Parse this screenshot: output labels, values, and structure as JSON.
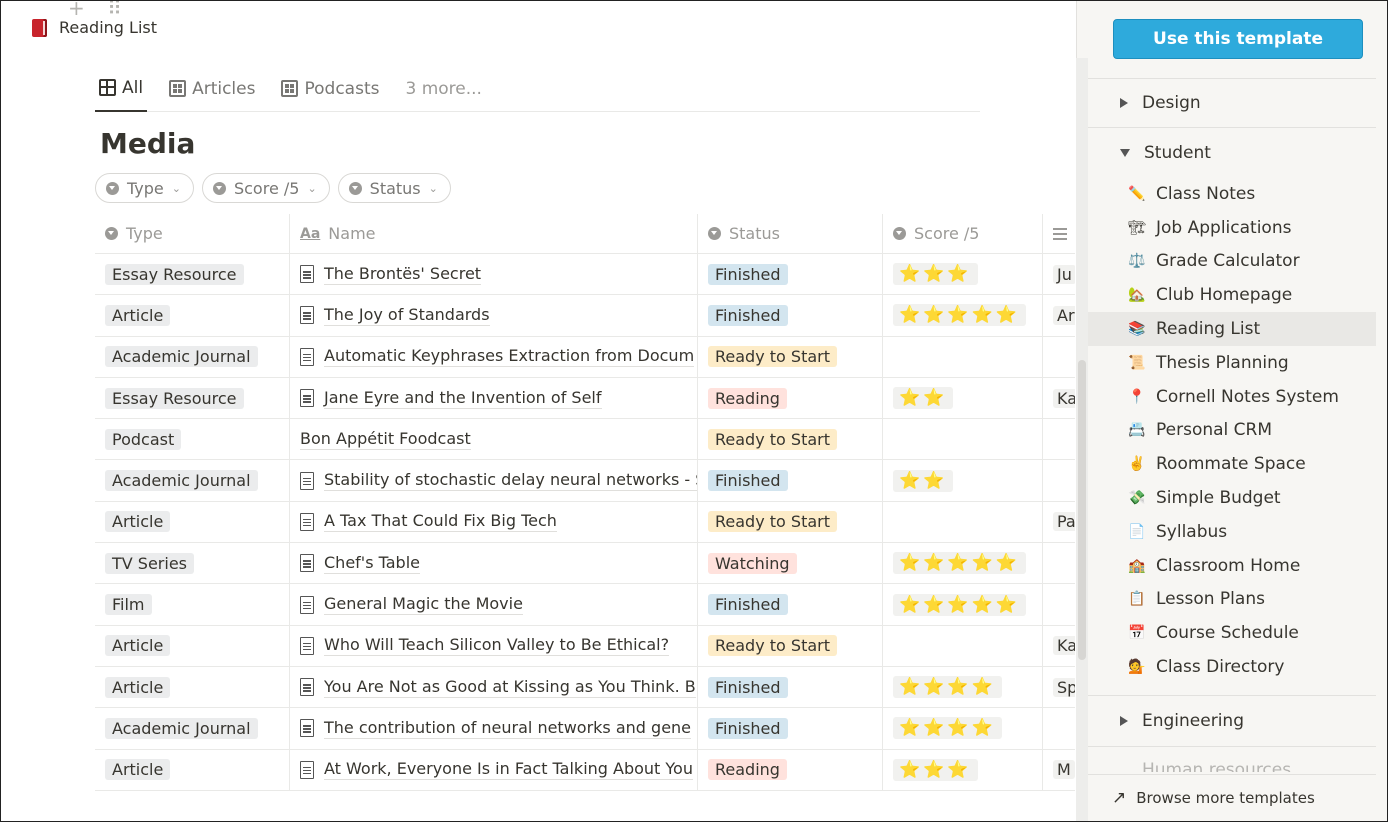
{
  "page": {
    "breadcrumb": "Reading List",
    "title": "Media"
  },
  "tabs": [
    {
      "label": "All"
    },
    {
      "label": "Articles"
    },
    {
      "label": "Podcasts"
    },
    {
      "label": "3 more..."
    }
  ],
  "filters": [
    "Type",
    "Score /5",
    "Status"
  ],
  "columns": {
    "type": "Type",
    "name": "Name",
    "status": "Status",
    "score": "Score /5"
  },
  "rows": [
    {
      "type": "Essay Resource",
      "name": "The Brontës' Secret",
      "status": "Finished",
      "score": "⭐⭐⭐",
      "extra": "Ju"
    },
    {
      "type": "Article",
      "name": "The Joy of Standards",
      "status": "Finished",
      "score": "⭐⭐⭐⭐⭐",
      "extra": "Ar"
    },
    {
      "type": "Academic Journal",
      "name": "Automatic Keyphrases Extraction from Docum",
      "status": "Ready to Start",
      "score": "",
      "extra": ""
    },
    {
      "type": "Essay Resource",
      "name": "Jane Eyre and the Invention of Self",
      "status": "Reading",
      "score": "⭐⭐",
      "extra": "Ka"
    },
    {
      "type": "Podcast",
      "name": "Bon Appétit Foodcast",
      "status": "Ready to Start",
      "score": "",
      "extra": ""
    },
    {
      "type": "Academic Journal",
      "name": "Stability of stochastic delay neural networks - S",
      "status": "Finished",
      "score": "⭐⭐",
      "extra": ""
    },
    {
      "type": "Article",
      "name": "A Tax That Could Fix Big Tech",
      "status": "Ready to Start",
      "score": "",
      "extra": "Pa"
    },
    {
      "type": "TV Series",
      "name": "Chef's Table",
      "status": "Watching",
      "score": "⭐⭐⭐⭐⭐",
      "extra": ""
    },
    {
      "type": "Film",
      "name": "General Magic the Movie",
      "status": "Finished",
      "score": "⭐⭐⭐⭐⭐",
      "extra": ""
    },
    {
      "type": "Article",
      "name": "Who Will Teach Silicon Valley to Be Ethical?",
      "status": "Ready to Start",
      "score": "",
      "extra": "Ka"
    },
    {
      "type": "Article",
      "name": "You Are Not as Good at Kissing as You Think. B",
      "status": "Finished",
      "score": "⭐⭐⭐⭐",
      "extra": "Sp"
    },
    {
      "type": "Academic Journal",
      "name": "The contribution of neural networks and gene",
      "status": "Finished",
      "score": "⭐⭐⭐⭐",
      "extra": ""
    },
    {
      "type": "Article",
      "name": "At Work, Everyone Is in Fact Talking About You",
      "status": "Reading",
      "score": "⭐⭐⭐",
      "extra": "M"
    }
  ],
  "sidebar": {
    "use_template": "Use this template",
    "categories": {
      "design": "Design",
      "student": "Student",
      "engineering": "Engineering",
      "next": "Human resources"
    },
    "templates": [
      {
        "label": "Class Notes",
        "icon": "✏️"
      },
      {
        "label": "Job Applications",
        "icon": "🏗"
      },
      {
        "label": "Grade Calculator",
        "icon": "⚖️"
      },
      {
        "label": "Club Homepage",
        "icon": "🏡"
      },
      {
        "label": "Reading List",
        "icon": "📚"
      },
      {
        "label": "Thesis Planning",
        "icon": "📜"
      },
      {
        "label": "Cornell Notes System",
        "icon": "📍"
      },
      {
        "label": "Personal CRM",
        "icon": "📇"
      },
      {
        "label": "Roommate Space",
        "icon": "✌️"
      },
      {
        "label": "Simple Budget",
        "icon": "💸"
      },
      {
        "label": "Syllabus",
        "icon": "📄"
      },
      {
        "label": "Classroom Home",
        "icon": "🏫"
      },
      {
        "label": "Lesson Plans",
        "icon": "📋"
      },
      {
        "label": "Course Schedule",
        "icon": "📅"
      },
      {
        "label": "Class Directory",
        "icon": "💁"
      }
    ],
    "active_template": "Reading List",
    "browse": "Browse more templates"
  }
}
